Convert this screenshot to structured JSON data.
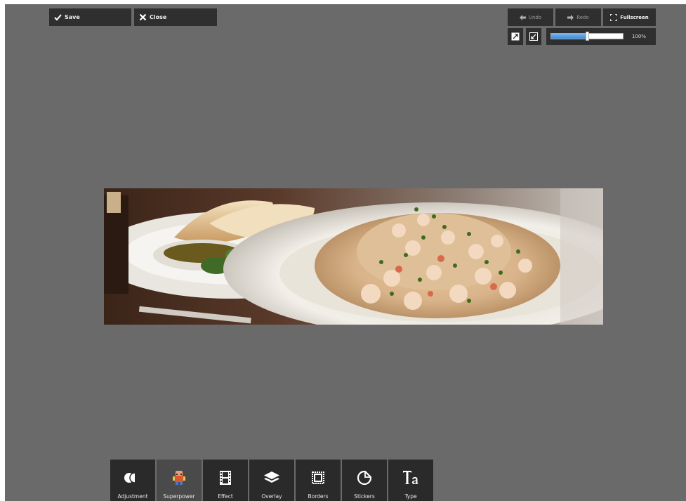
{
  "toolbar_top": {
    "save_label": "Save",
    "close_label": "Close",
    "undo_label": "Undo",
    "redo_label": "Redo",
    "fullscreen_label": "Fullscreen"
  },
  "zoom": {
    "value": 0.5,
    "label": "100%"
  },
  "tools": [
    {
      "label": "Adjustment",
      "icon": "adjustment-icon"
    },
    {
      "label": "Superpower",
      "icon": "superpower-icon"
    },
    {
      "label": "Effect",
      "icon": "effect-icon"
    },
    {
      "label": "Overlay",
      "icon": "overlay-icon"
    },
    {
      "label": "Borders",
      "icon": "borders-icon"
    },
    {
      "label": "Stickers",
      "icon": "stickers-icon"
    },
    {
      "label": "Type",
      "icon": "type-icon"
    }
  ],
  "active_tool": "Superpower",
  "colors": {
    "canvas_bg": "#6a6a6a",
    "button_bg": "#2f2f2f",
    "slider_accent": "#3f88d6"
  },
  "photo": {
    "subject": "plate of shrimp pasta with bread and dipping oil"
  }
}
